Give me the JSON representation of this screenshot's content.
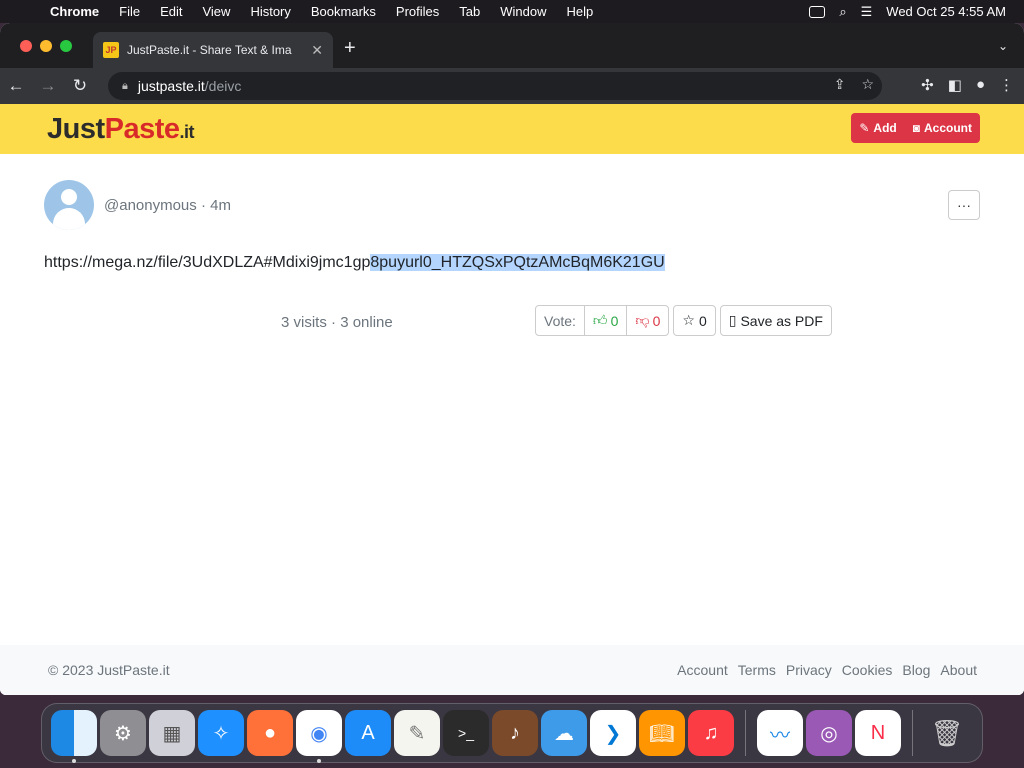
{
  "menubar": {
    "app_name": "Chrome",
    "items": [
      "File",
      "Edit",
      "View",
      "History",
      "Bookmarks",
      "Profiles",
      "Tab",
      "Window",
      "Help"
    ],
    "datetime": "Wed Oct 25  4:55 AM"
  },
  "browser": {
    "tab_title": "JustPaste.it - Share Text & Ima",
    "favicon_text": "JP",
    "url_domain": "justpaste.it",
    "url_path": "/deivc"
  },
  "site": {
    "logo": {
      "just": "Just",
      "paste": "Paste",
      "dotit": ".it"
    },
    "add_label": "Add",
    "account_label": "Account"
  },
  "post": {
    "author": "@anonymous",
    "age": "4m",
    "more_label": "···",
    "text_before_selection": "https://mega.nz/file/3UdXDLZA#Mdixi9jmc1gp",
    "text_selected": "8puyurl0_HTZQSxPQtzAMcBqM6K21GU",
    "visits": "3 visits",
    "online": "3 online",
    "vote_label": "Vote:",
    "upvotes": "0",
    "downvotes": "0",
    "stars": "0",
    "save_pdf_label": "Save as PDF"
  },
  "footer": {
    "copyright": "© 2023 JustPaste.it",
    "links": [
      "Account",
      "Terms",
      "Privacy",
      "Cookies",
      "Blog",
      "About"
    ]
  },
  "colors": {
    "header_yellow": "#fddc4b",
    "brand_red": "#d92a2a",
    "button_red": "#dc3545",
    "selection_blue": "#b4d5fe"
  },
  "dock": {
    "apps": [
      "Finder",
      "System Settings",
      "Launchpad",
      "Safari",
      "Firefox",
      "Chrome",
      "App Store",
      "TextEdit",
      "Terminal",
      "GarageBand",
      "iCloud",
      "VS Code",
      "Books",
      "Music",
      "Freeform",
      "Podcasts",
      "News",
      "Trash"
    ]
  }
}
